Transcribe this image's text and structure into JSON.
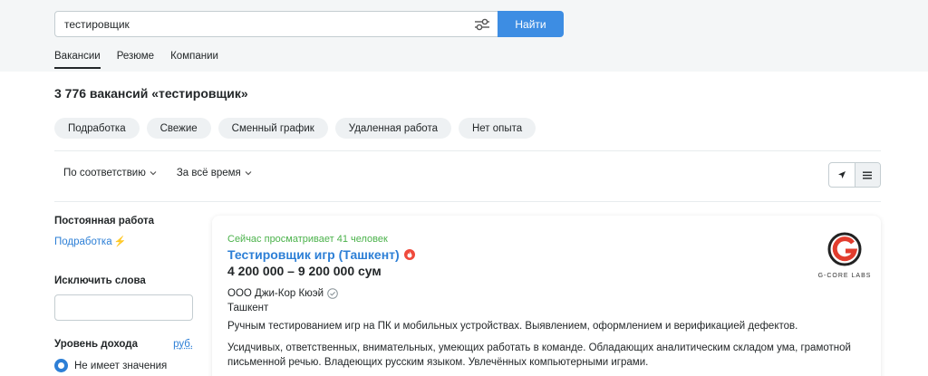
{
  "search": {
    "value": "тестировщик",
    "button_label": "Найти"
  },
  "tabs": [
    {
      "label": "Вакансии",
      "active": true
    },
    {
      "label": "Резюме",
      "active": false
    },
    {
      "label": "Компании",
      "active": false
    }
  ],
  "results_title": "3 776 вакансий «тестировщик»",
  "chips": [
    "Подработка",
    "Свежие",
    "Сменный график",
    "Удаленная работа",
    "Нет опыта"
  ],
  "sort": {
    "relevance": "По соответствию",
    "period": "За всё время"
  },
  "sidebar": {
    "employment_heading": "Постоянная работа",
    "employment_link": "Подработка",
    "exclude_heading": "Исключить слова",
    "income_heading": "Уровень дохода",
    "currency": "руб.",
    "income_option": "Не имеет значения"
  },
  "vacancy": {
    "viewers": "Сейчас просматривает 41 человек",
    "title": "Тестировщик игр (Ташкент)",
    "salary": "4 200 000 – 9 200 000 сум",
    "company": "ООО Джи-Кор Кюэй",
    "city": "Ташкент",
    "description1": "Ручным тестированием игр на ПК и мобильных устройствах. Выявлением, оформлением и верификацией дефектов.",
    "description2": "Усидчивых, ответственных, внимательных, умеющих работать в команде. Обладающих аналитическим складом ума, грамотной письменной речью. Владеющих русским языком. Увлечённых компьютерными играми.",
    "logo_text": "G-CORE LABS"
  },
  "colors": {
    "accent": "#3d8de3",
    "link": "#2d7fd6",
    "viewers": "#4bb24b",
    "hot": "#ef4a3c"
  },
  "icons": [
    "filter-icon",
    "chevron-down-icon",
    "location-arrow-icon",
    "list-icon",
    "fire-icon",
    "verified-check-icon",
    "lightning-icon"
  ]
}
